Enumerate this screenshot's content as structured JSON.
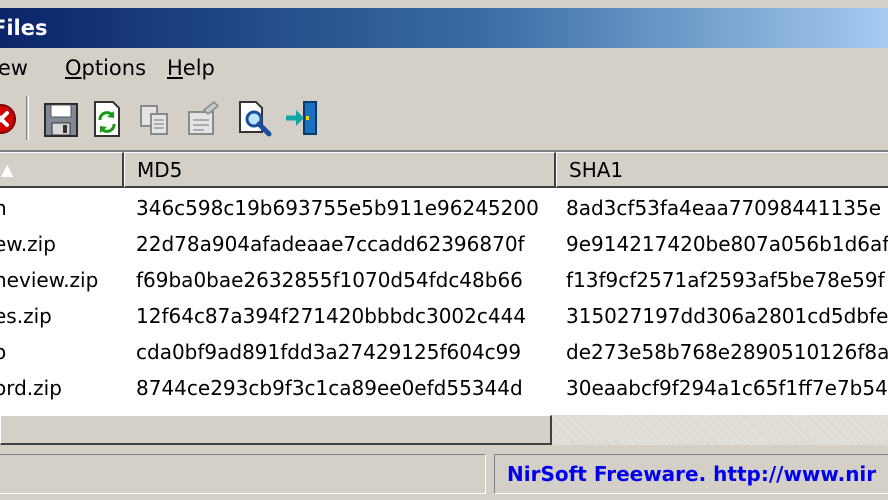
{
  "window": {
    "title": "Files",
    "colors": {
      "title_start": "#0a246a",
      "title_end": "#a6caf0",
      "link": "#0000ee"
    }
  },
  "menu": {
    "items": [
      {
        "pre": "",
        "key": "",
        "post": "iew"
      },
      {
        "pre": "",
        "key": "O",
        "post": "ptions"
      },
      {
        "pre": "",
        "key": "H",
        "post": "elp"
      }
    ]
  },
  "toolbar": {
    "buttons": [
      {
        "icon": "stop-icon"
      },
      {
        "icon": "save-icon"
      },
      {
        "icon": "refresh-icon"
      },
      {
        "icon": "copy-icon"
      },
      {
        "icon": "properties-icon"
      },
      {
        "icon": "find-icon"
      },
      {
        "icon": "exit-icon"
      }
    ]
  },
  "table": {
    "columns": [
      "",
      "MD5",
      "SHA1"
    ],
    "rows": [
      {
        "name": "n",
        "md5": "346c598c19b693755e5b911e96245200",
        "sha1": "8ad3cf53fa4eaa77098441135e"
      },
      {
        "name": "ew.zip",
        "md5": "22d78a904afadeaae7ccadd62396870f",
        "sha1": "9e914217420be807a056b1d6af"
      },
      {
        "name": "neview.zip",
        "md5": "f69ba0bae2632855f1070d54fdc48b66",
        "sha1": "f13f9cf2571af2593af5be78e59f"
      },
      {
        "name": "es.zip",
        "md5": "12f64c87a394f271420bbbdc3002c444",
        "sha1": "315027197dd306a2801cd5dbfe"
      },
      {
        "name": "o",
        "md5": "cda0bf9ad891fdd3a27429125f604c99",
        "sha1": "de273e58b768e2890510126f8a"
      },
      {
        "name": "ord.zip",
        "md5": "8744ce293cb9f3c1ca89ee0efd55344d",
        "sha1": "30eaabcf9f294a1c65f1ff7e7b54"
      }
    ]
  },
  "statusbar": {
    "left_text": "",
    "link_text": "NirSoft Freeware.  http://www.nir"
  }
}
